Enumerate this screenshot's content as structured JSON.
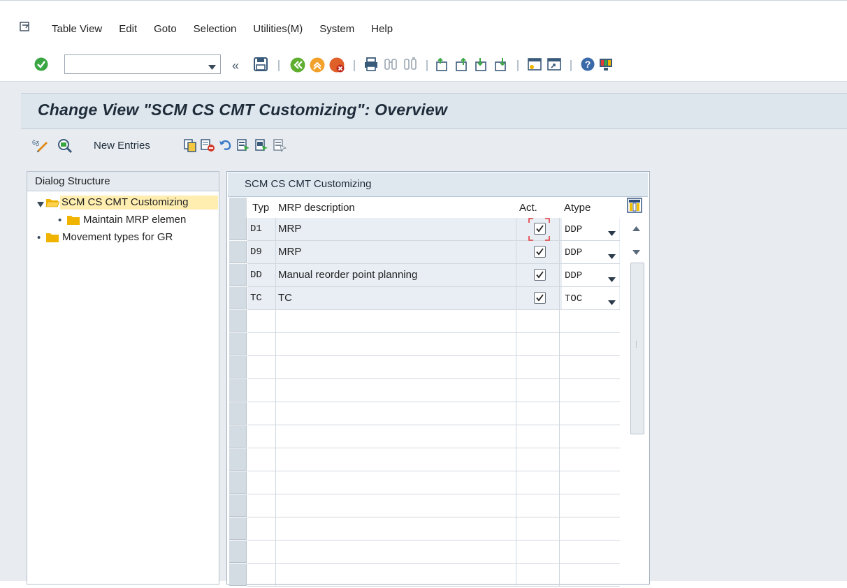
{
  "menu": {
    "items": [
      "Table View",
      "Edit",
      "Goto",
      "Selection",
      "Utilities(M)",
      "System",
      "Help"
    ]
  },
  "std_toolbar": {
    "command_field_value": "",
    "icons": [
      "enter-icon",
      "back-double-arrow-icon",
      "save-icon",
      "back-icon",
      "exit-icon",
      "cancel-icon",
      "print-icon",
      "find-icon",
      "find-next-icon",
      "first-page-icon",
      "previous-page-icon",
      "next-page-icon",
      "last-page-icon",
      "create-session-icon",
      "shortcut-icon",
      "help-icon",
      "customize-layout-icon"
    ]
  },
  "title": "Change View \"SCM CS CMT Customizing\": Overview",
  "app_toolbar": {
    "new_entries": "New Entries"
  },
  "dialog_structure": {
    "header": "Dialog Structure",
    "nodes": [
      {
        "label": "SCM CS CMT Customizing",
        "level": 0,
        "expanded": true,
        "selected": true
      },
      {
        "label": "Maintain MRP elemen",
        "level": 1
      },
      {
        "label": "Movement types for GR",
        "level": 0
      }
    ]
  },
  "table": {
    "caption": "SCM CS CMT Customizing",
    "columns": {
      "typ": "Typ",
      "desc": "MRP description",
      "act": "Act.",
      "atype": "Atype"
    },
    "rows": [
      {
        "typ": "D1",
        "desc": "MRP",
        "act": true,
        "atype": "DDP"
      },
      {
        "typ": "D9",
        "desc": "MRP",
        "act": true,
        "atype": "DDP"
      },
      {
        "typ": "DD",
        "desc": "Manual reorder point planning",
        "act": true,
        "atype": "DDP"
      },
      {
        "typ": "TC",
        "desc": "TC",
        "act": true,
        "atype": "TOC"
      }
    ],
    "empty_rows": 12
  },
  "colors": {
    "title_bg": "#dde5ed",
    "work_bg": "#e8ecf0",
    "tree_selected_bg": "#ffeeb0",
    "folder": "#f0b400",
    "focus_corner": "#e23b3b"
  }
}
